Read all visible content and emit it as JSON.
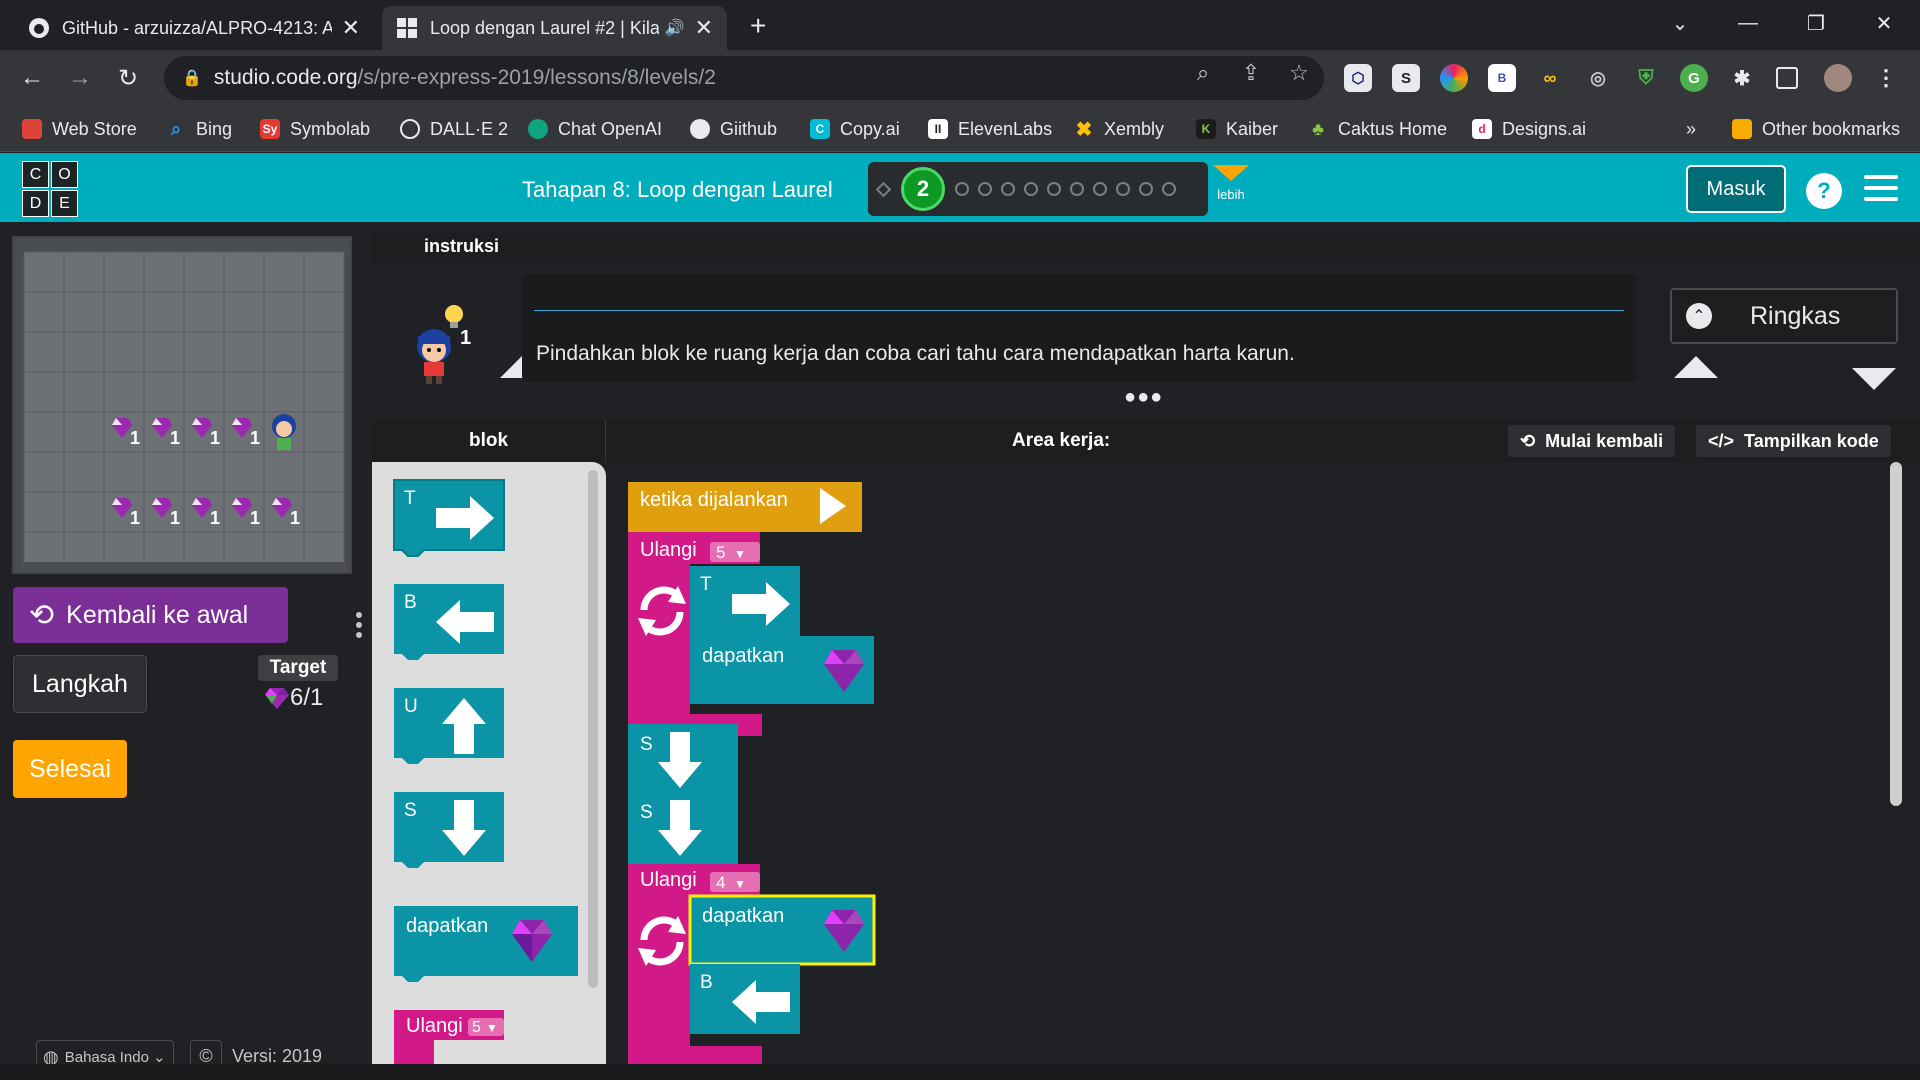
{
  "browser": {
    "tabs": [
      {
        "title": "GitHub - arzuizza/ALPRO-4213: A",
        "icon": "github-icon",
        "active": false
      },
      {
        "title": "Loop dengan Laurel #2 | Kila",
        "icon": "code-org-icon",
        "active": true
      }
    ],
    "url_host": "studio.code.org",
    "url_path": "/s/pre-express-2019/lessons/8/levels/2",
    "bookmarks": [
      "Web Store",
      "Bing",
      "Symbolab",
      "DALL·E 2",
      "Chat OpenAI",
      "Giithub",
      "Copy.ai",
      "ElevenLabs",
      "Xembly",
      "Kaiber",
      "Caktus Home",
      "Designs.ai"
    ],
    "bookmarks_more": "»",
    "other_bookmarks": "Other bookmarks"
  },
  "header": {
    "stage_title": "Tahapan 8: Loop dengan Laurel",
    "current_level": "2",
    "more_label": "lebih",
    "signin_label": "Masuk",
    "help_label": "?"
  },
  "left": {
    "reset_label": "Kembali ke awal",
    "step_label": "Langkah",
    "target_label": "Target",
    "target_value": "6/1",
    "finish_label": "Selesai",
    "language": "Bahasa Indo",
    "copyright": "©",
    "version": "Versi: 2019"
  },
  "instructions": {
    "header": "instruksi",
    "text": "Pindahkan blok ke ruang kerja dan coba cari tahu cara mendapatkan harta karun.",
    "collapse_label": "Ringkas"
  },
  "workspace": {
    "toolbox_title": "blok",
    "area_title": "Area kerja:",
    "restart_label": "Mulai kembali",
    "show_code_label": "Tampilkan kode"
  },
  "toolbox_blocks": {
    "east": "T",
    "west": "B",
    "north": "U",
    "south": "S",
    "collect": "dapatkan",
    "repeat": "Ulangi",
    "repeat_count": "5"
  },
  "program": {
    "when_run": "ketika dijalankan",
    "repeat1": "Ulangi",
    "repeat1_count": "5",
    "move1": "T",
    "collect1": "dapatkan",
    "move2": "S",
    "move3": "S",
    "repeat2": "Ulangi",
    "repeat2_count": "4",
    "collect2": "dapatkan",
    "move4": "B"
  },
  "maze": {
    "gem_count_label": "1"
  }
}
